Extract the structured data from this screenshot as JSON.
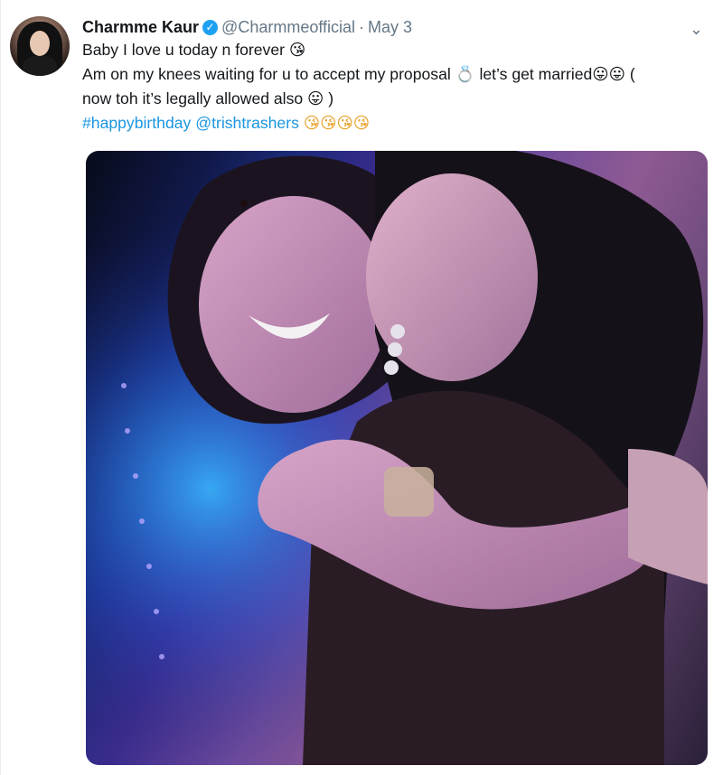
{
  "tweet": {
    "author": {
      "name": "Charmme Kaur",
      "handle": "@Charmmeofficial",
      "verified_icon": "verified-badge-icon",
      "avatar_icon": "profile-avatar"
    },
    "separator": "·",
    "date": "May 3",
    "menu_icon": "chevron-down-icon",
    "text_lines": [
      "Baby I love u today n forever 😘",
      "Am on my knees waiting for u to accept my proposal 💍 let’s get married😛😛 (",
      "now toh it’s legally allowed also 😛 )"
    ],
    "hashtag": "#happybirthday",
    "mention": "@trishtrashers",
    "trailing_emojis": "😘😘😘😘"
  },
  "colors": {
    "link": "#1b95e0",
    "verified": "#1da1f2",
    "secondary_text": "#657786",
    "primary_text": "#14171a"
  }
}
